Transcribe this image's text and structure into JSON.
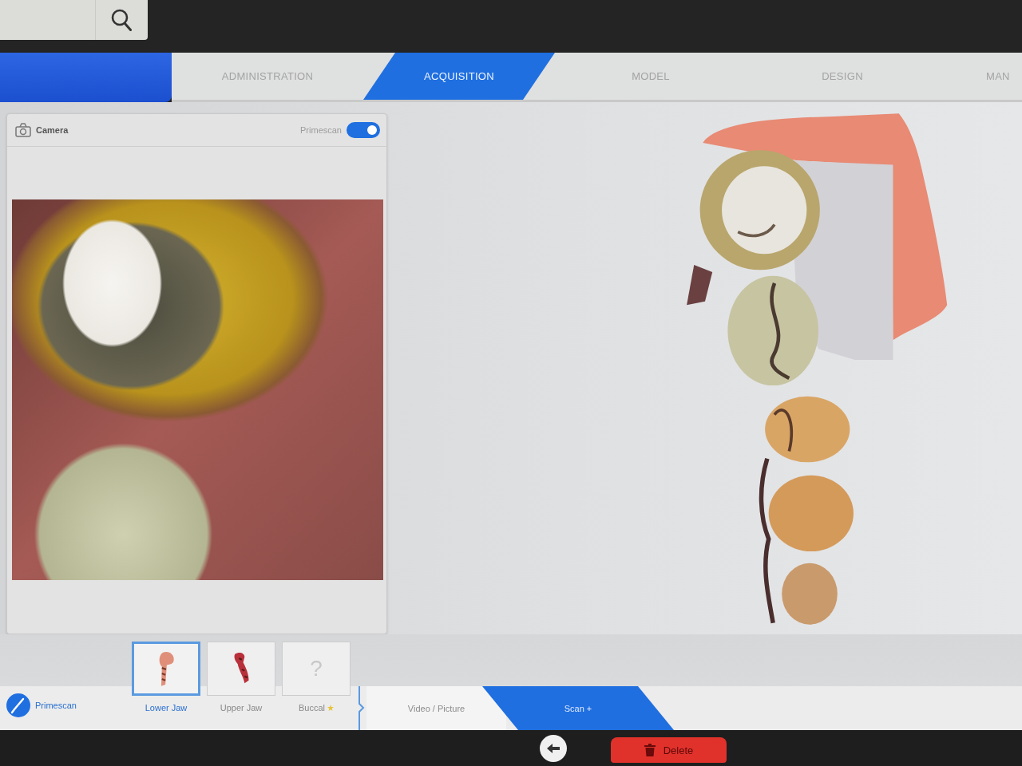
{
  "tabs": [
    {
      "label": "ADMINISTRATION",
      "selected": false
    },
    {
      "label": "ACQUISITION",
      "selected": true
    },
    {
      "label": "MODEL",
      "selected": false
    },
    {
      "label": "DESIGN",
      "selected": false
    },
    {
      "label": "MAN",
      "selected": false
    }
  ],
  "camera_panel": {
    "title": "Camera",
    "toggle": {
      "label": "Primescan",
      "on": true
    }
  },
  "scanner": {
    "label": "Primescan"
  },
  "catalog": [
    {
      "kind": "lower",
      "label": "Lower Jaw",
      "selected": true,
      "marked": false
    },
    {
      "kind": "upper",
      "label": "Upper Jaw",
      "selected": false,
      "marked": false
    },
    {
      "kind": "empty",
      "thumb_text": "?",
      "label": "Buccal",
      "selected": false,
      "marked": true
    }
  ],
  "modes": [
    {
      "label": "Video / Picture",
      "selected": false
    },
    {
      "label": "Scan +",
      "selected": true
    }
  ],
  "actions": [
    {
      "kind": "back"
    },
    {
      "kind": "delete",
      "label": "Delete"
    }
  ]
}
